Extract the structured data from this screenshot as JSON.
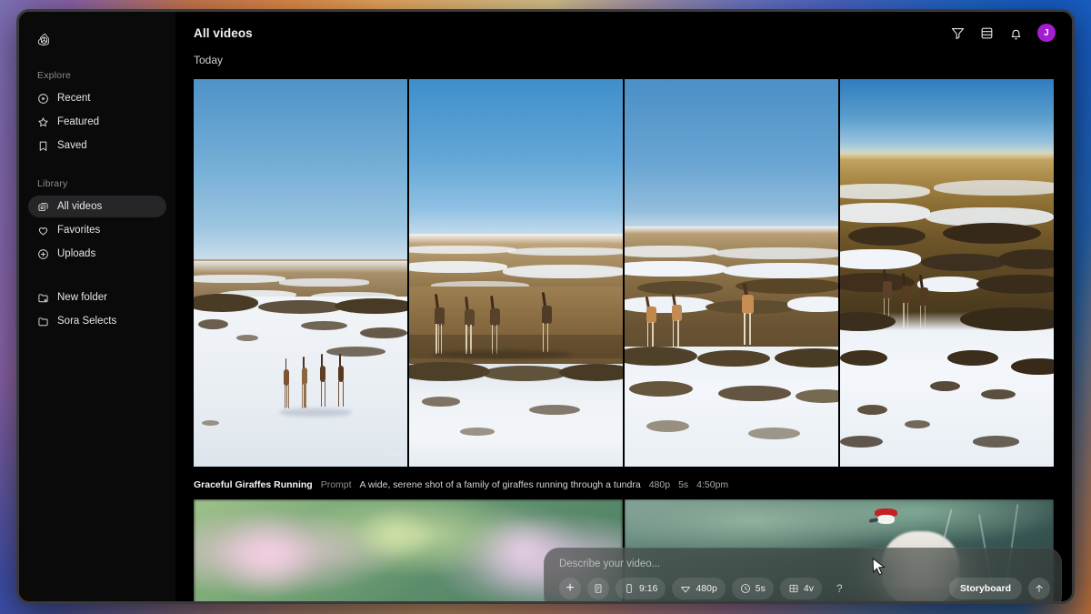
{
  "app": {
    "window_title": "Sora",
    "logo_icon": "openai-spiral-icon"
  },
  "sidebar": {
    "groups": [
      {
        "label": "Explore",
        "items": [
          {
            "label": "Recent",
            "icon": "play-circle-icon",
            "active": false
          },
          {
            "label": "Featured",
            "icon": "star-icon",
            "active": false
          },
          {
            "label": "Saved",
            "icon": "bookmark-icon",
            "active": false
          }
        ]
      },
      {
        "label": "Library",
        "items": [
          {
            "label": "All videos",
            "icon": "stacked-frames-icon",
            "active": true
          },
          {
            "label": "Favorites",
            "icon": "heart-icon",
            "active": false
          },
          {
            "label": "Uploads",
            "icon": "plus-circle-icon",
            "active": false
          }
        ]
      },
      {
        "label": "",
        "items": [
          {
            "label": "New folder",
            "icon": "folder-plus-icon",
            "active": false
          },
          {
            "label": "Sora Selects",
            "icon": "folder-icon",
            "active": false
          }
        ]
      }
    ]
  },
  "topbar": {
    "title": "All videos",
    "icons": [
      {
        "name": "filter-icon"
      },
      {
        "name": "list-layout-icon"
      },
      {
        "name": "bell-icon"
      }
    ],
    "avatar_initial": "J",
    "avatar_color": "#a21ed0"
  },
  "main": {
    "section_label": "Today",
    "row1": {
      "tiles": [
        {
          "alt": "Aerial shot of four giraffes walking across snowy tundra"
        },
        {
          "alt": "Four giraffes running on dry grass between snow patches"
        },
        {
          "alt": "Three giraffes on a snow-mottled plain seen from above"
        },
        {
          "alt": "Three giraffes with long shadows on sunlit snowy ground"
        }
      ],
      "meta": {
        "title": "Graceful Giraffes Running",
        "prompt_key": "Prompt",
        "prompt": "A wide, serene shot of a family of giraffes running through a tundra",
        "resolution": "480p",
        "duration": "5s",
        "time": "4:50pm"
      }
    },
    "row2": {
      "tiles": [
        {
          "alt": "Soft pink cherry blossom branches against green foliage"
        },
        {
          "alt": "Red-crowned crane beside a misty winter river"
        }
      ]
    }
  },
  "composer": {
    "placeholder": "Describe your video...",
    "add_label": "+",
    "chips": [
      {
        "name": "preset-chip",
        "icon": "document-icon",
        "label": ""
      },
      {
        "name": "aspect-chip",
        "icon": "phone-icon",
        "label": "9:16"
      },
      {
        "name": "resolution-chip",
        "icon": "diamond-icon",
        "label": "480p"
      },
      {
        "name": "duration-chip",
        "icon": "clock-icon",
        "label": "5s"
      },
      {
        "name": "variations-chip",
        "icon": "grid-icon",
        "label": "4v"
      },
      {
        "name": "help-chip",
        "icon": "question-icon",
        "label": "?"
      }
    ],
    "storyboard_label": "Storyboard",
    "send_icon": "arrow-up-icon"
  }
}
